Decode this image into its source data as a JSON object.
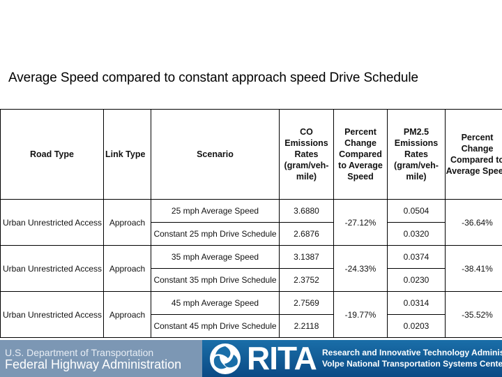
{
  "title": "Average Speed compared to constant approach speed Drive Schedule",
  "table": {
    "headers": [
      "Road Type",
      "Link Type",
      "Scenario",
      "CO Emissions Rates (gram/veh-mile)",
      "Percent Change Compared to Average Speed",
      "PM2.5 Emissions Rates (gram/veh-mile)",
      "Percent Change Compared to Average Speed"
    ],
    "groups": [
      {
        "road_type": "Urban Unrestricted Access",
        "link_type": "Approach",
        "scenarios": [
          "25 mph Average Speed",
          "Constant 25 mph Drive Schedule"
        ],
        "co_rates": [
          "3.6880",
          "2.6876"
        ],
        "co_change": "-27.12%",
        "pm_rates": [
          "0.0504",
          "0.0320"
        ],
        "pm_change": "-36.64%"
      },
      {
        "road_type": "Urban Unrestricted Access",
        "link_type": "Approach",
        "scenarios": [
          "35 mph Average Speed",
          "Constant 35 mph Drive Schedule"
        ],
        "co_rates": [
          "3.1387",
          "2.3752"
        ],
        "co_change": "-24.33%",
        "pm_rates": [
          "0.0374",
          "0.0230"
        ],
        "pm_change": "-38.41%"
      },
      {
        "road_type": "Urban Unrestricted Access",
        "link_type": "Approach",
        "scenarios": [
          "45 mph Average Speed",
          "Constant 45 mph Drive Schedule"
        ],
        "co_rates": [
          "2.7569",
          "2.2118"
        ],
        "co_change": "-19.77%",
        "pm_rates": [
          "0.0314",
          "0.0203"
        ],
        "pm_change": "-35.52%"
      }
    ]
  },
  "footer": {
    "dot_line": "U.S. Department of Transportation",
    "fhwa_line": "Federal Highway Administration",
    "rita_word": "RITA",
    "rita_line1": "Research and Innovative Technology Administration",
    "rita_line2": "Volpe National Transportation Systems Center",
    "colors": {
      "fhwa_bg": "#7c97b4",
      "rita_bg": "#0b4a85"
    }
  }
}
